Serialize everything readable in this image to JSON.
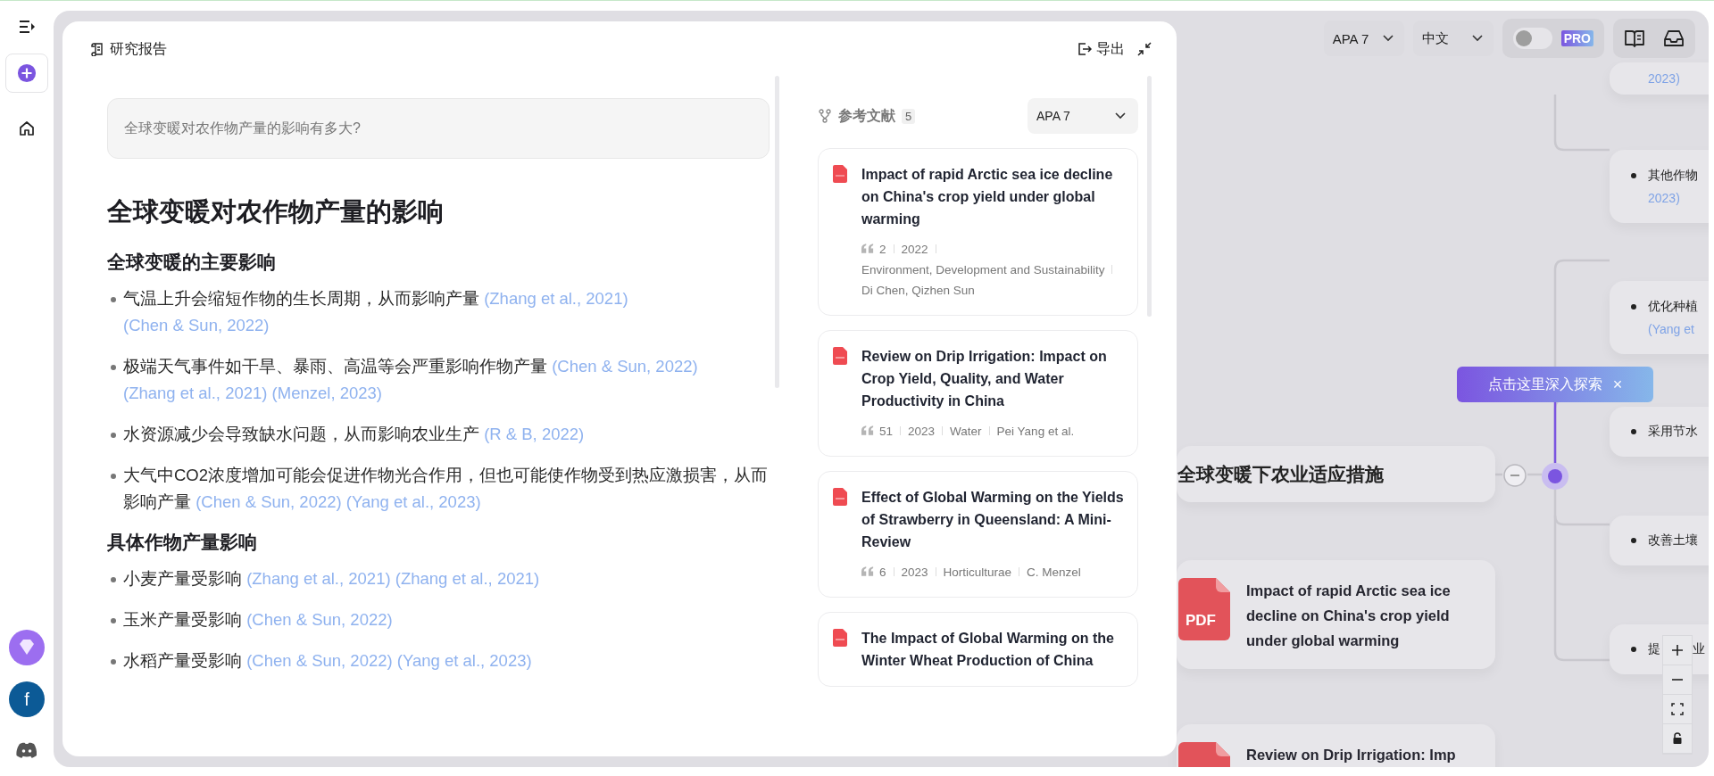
{
  "sidebar": {
    "avatar_letter": "f"
  },
  "report": {
    "title": "研究报告",
    "export_label": "导出",
    "question": "全球变暖对农作物产量的影响有多大?",
    "heading": "全球变暖对农作物产量的影响",
    "sections": [
      {
        "heading": "全球变暖的主要影响",
        "bullets": [
          {
            "text": "气温上升会缩短作物的生长周期，从而影响产量",
            "citations": [
              "(Zhang et al., 2021)",
              "(Chen & Sun, 2022)"
            ]
          },
          {
            "text": "极端天气事件如干旱、暴雨、高温等会严重影响作物产量",
            "citations": [
              "(Chen & Sun, 2022)",
              "(Zhang et al., 2021)",
              "(Menzel, 2023)"
            ]
          },
          {
            "text": "水资源减少会导致缺水问题，从而影响农业生产",
            "citations": [
              "(R & B, 2022)"
            ]
          },
          {
            "text": "大气中CO2浓度增加可能会促进作物光合作用，但也可能使作物受到热应激损害，从而影响产量",
            "citations": [
              "(Chen & Sun, 2022)",
              "(Yang et al., 2023)"
            ]
          }
        ]
      },
      {
        "heading": "具体作物产量影响",
        "bullets": [
          {
            "text": "小麦产量受影响",
            "citations": [
              "(Zhang et al., 2021)",
              "(Zhang et al., 2021)"
            ]
          },
          {
            "text": "玉米产量受影响",
            "citations": [
              "(Chen & Sun, 2022)"
            ]
          },
          {
            "text": "水稻产量受影响",
            "citations": [
              "(Chen & Sun, 2022)",
              "(Yang et al., 2023)"
            ]
          }
        ]
      }
    ]
  },
  "references": {
    "title": "参考文献",
    "count": "5",
    "style": "APA 7",
    "items": [
      {
        "title": "Impact of rapid Arctic sea ice decline on China's crop yield under global warming",
        "citations": "2",
        "year": "2022",
        "source": "Environment, Development and Sustainability",
        "authors": "Di Chen, Qizhen Sun"
      },
      {
        "title": "Review on Drip Irrigation: Impact on Crop Yield, Quality, and Water Productivity in China",
        "citations": "51",
        "year": "2023",
        "source": "Water",
        "authors": "Pei Yang et al."
      },
      {
        "title": "Effect of Global Warming on the Yields of Strawberry in Queensland: A Mini-Review",
        "citations": "6",
        "year": "2023",
        "source": "Horticulturae",
        "authors": "C. Menzel"
      },
      {
        "title": "The Impact of Global Warming on the Winter Wheat Production of China"
      }
    ]
  },
  "toolbar": {
    "citation_style": "APA 7",
    "language": "中文",
    "pro_toggle": {
      "on": false,
      "badge": "PRO"
    }
  },
  "mindmap": {
    "nodes": [
      {
        "kind": "bullet",
        "cite": "2023)"
      },
      {
        "kind": "bullet",
        "text": "其他作物",
        "cite": "2023)"
      },
      {
        "kind": "bullet",
        "text": "优化种植",
        "cite": "(Yang et"
      },
      {
        "kind": "bullet",
        "text": "采用节水"
      },
      {
        "kind": "bullet",
        "text": "改善土壤"
      },
      {
        "kind": "bullet",
        "text": "提",
        "text_tail": "业"
      },
      {
        "kind": "topic",
        "text": "全球变暖下农业适应措施"
      },
      {
        "kind": "pdf",
        "icon_label": "PDF",
        "title": "Impact of rapid Arctic sea ice decline on China's crop yield under global warming"
      },
      {
        "kind": "pdf",
        "title": "Review on Drip Irrigation: Imp"
      }
    ],
    "tooltip": "点击这里深入探索",
    "tooltip_close": "×"
  }
}
